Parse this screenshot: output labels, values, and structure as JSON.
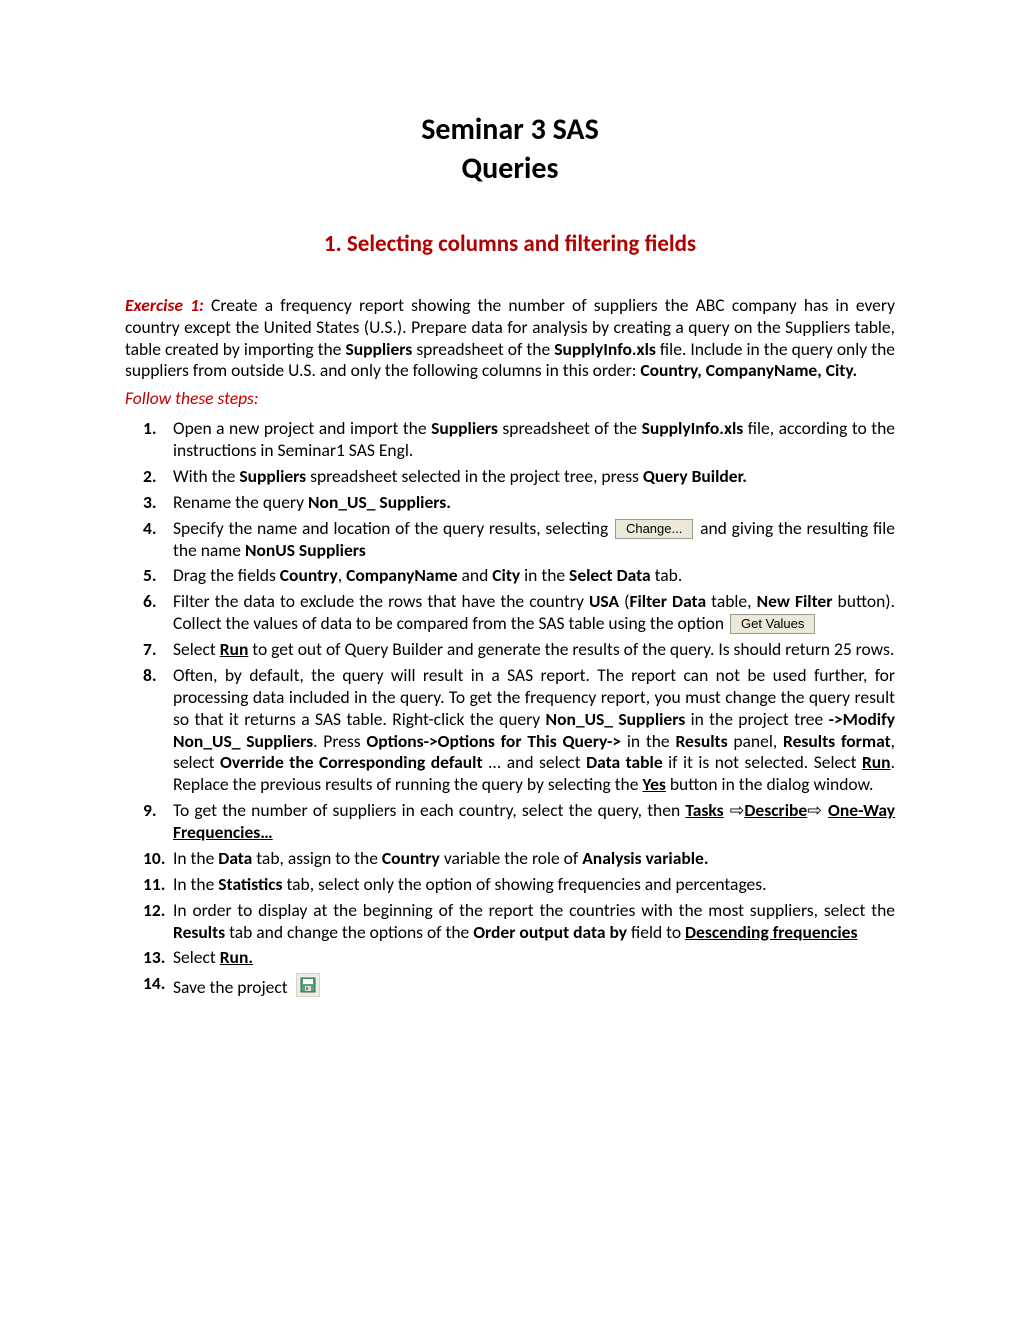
{
  "title_line1": "Seminar 3 SAS",
  "title_line2": "Queries",
  "section_heading": "1.  Selecting columns and filtering fields",
  "exercise_label": "Exercise 1:",
  "intro_parts": {
    "p1": "   Create a frequency report showing the number of suppliers the ABC company has in every country except the United States (U.S.). Prepare data for analysis by creating a query on the Suppliers table, table created by importing the ",
    "b1": "Suppliers",
    "p2": " spreadsheet of the ",
    "b2": "SupplyInfo.xls",
    "p3": " file. Include in the query only the suppliers from outside U.S. and only the following columns in this order: ",
    "b3": "Country, CompanyName, City."
  },
  "follow_steps": "Follow these steps:",
  "buttons": {
    "change": "Change...",
    "get_values": "Get Values"
  },
  "steps": {
    "s1": {
      "n": "1.",
      "a": "Open a new project and import the ",
      "b1": "Suppliers",
      "a2": " spreadsheet of the ",
      "b2": "SupplyInfo.xls",
      "a3": " file, according to the instructions in Seminar1 SAS Engl."
    },
    "s2": {
      "n": "2.",
      "a": "With the ",
      "b1": "Suppliers",
      "a2": " spreadsheet selected in the project tree, press ",
      "b2": "Query Builder."
    },
    "s3": {
      "n": "3.",
      "a": "Rename the query ",
      "b1": "Non_US_ Suppliers."
    },
    "s4": {
      "n": "4.",
      "a": "Specify the name and location of the query results, selecting ",
      "a2": " and giving the resulting file the name ",
      "b1": "NonUS Suppliers"
    },
    "s5": {
      "n": "5.",
      "a": "Drag the fields ",
      "b1": "Country",
      "a2": ", ",
      "b2": "CompanyName",
      "a3": " and ",
      "b3": "City",
      "a4": " in the ",
      "b4": "Select Data",
      "a5": " tab."
    },
    "s6": {
      "n": "6.",
      "a": "Filter the data to exclude the rows that have the country ",
      "b1": "USA",
      "a2": " (",
      "b2": "Filter Data",
      "a3": " table, ",
      "b3": "New Filter",
      "a4": " button). Collect the values of data to be compared from the SAS table using the option "
    },
    "s7": {
      "n": "7.",
      "a": "Select ",
      "ub1": "Run",
      "a2": " to get out of Query Builder and generate the results of the query. Is should return 25 rows."
    },
    "s8": {
      "n": "8.",
      "a": "Often, by default, the query will result in a SAS report. The report can not be used further, for processing data included in the query. To get the frequency report, you must change the query result so that it returns a SAS table. Right-click the query ",
      "b1": "Non_US_ Suppliers",
      "a2": " in the project tree ",
      "b2": "->Modify Non_US_ Suppliers",
      "a3": ". Press ",
      "b3": "Options->Options for This Query->",
      "a4": " in the ",
      "b4": "Results",
      "a5": " panel, ",
      "b5": "Results format",
      "a6": ", select ",
      "b6": "Override the Corresponding default",
      "a7": " ... and select ",
      "b7": "Data table",
      "a8": " if it is not selected. Select ",
      "ub1": "Run",
      "a9": ". Replace the previous results of running the query by selecting the ",
      "ub2": "Yes",
      "a10": " button in the dialog window."
    },
    "s9": {
      "n": "9.",
      "a": "To get the number of suppliers in each country, select the query, then ",
      "ub1": "Tasks",
      "arr1": " ⇨",
      "ub2": "Describe",
      "arr2": "⇨ ",
      "ub3": "One-Way Frequencies…"
    },
    "s10": {
      "n": "10.",
      "a": "In the ",
      "b1": "Data",
      "a2": " tab, assign to the ",
      "b2": "Country",
      "a3": " variable the role of ",
      "b3": "Analysis variable."
    },
    "s11": {
      "n": "11.",
      "a": "In the ",
      "b1": "Statistics",
      "a2": " tab, select only the option of showing frequencies and percentages."
    },
    "s12": {
      "n": "12.",
      "a": "In order to display at the beginning of the report the countries with the most suppliers, select the ",
      "b1": "Results",
      "a2": " tab and change the options of the ",
      "b2": "Order output data by",
      "a3": " field to ",
      "ub1": "Descending frequencies"
    },
    "s13": {
      "n": "13.",
      "a": "Select ",
      "ub1": "Run."
    },
    "s14": {
      "n": "14.",
      "a": "Save the project "
    }
  }
}
